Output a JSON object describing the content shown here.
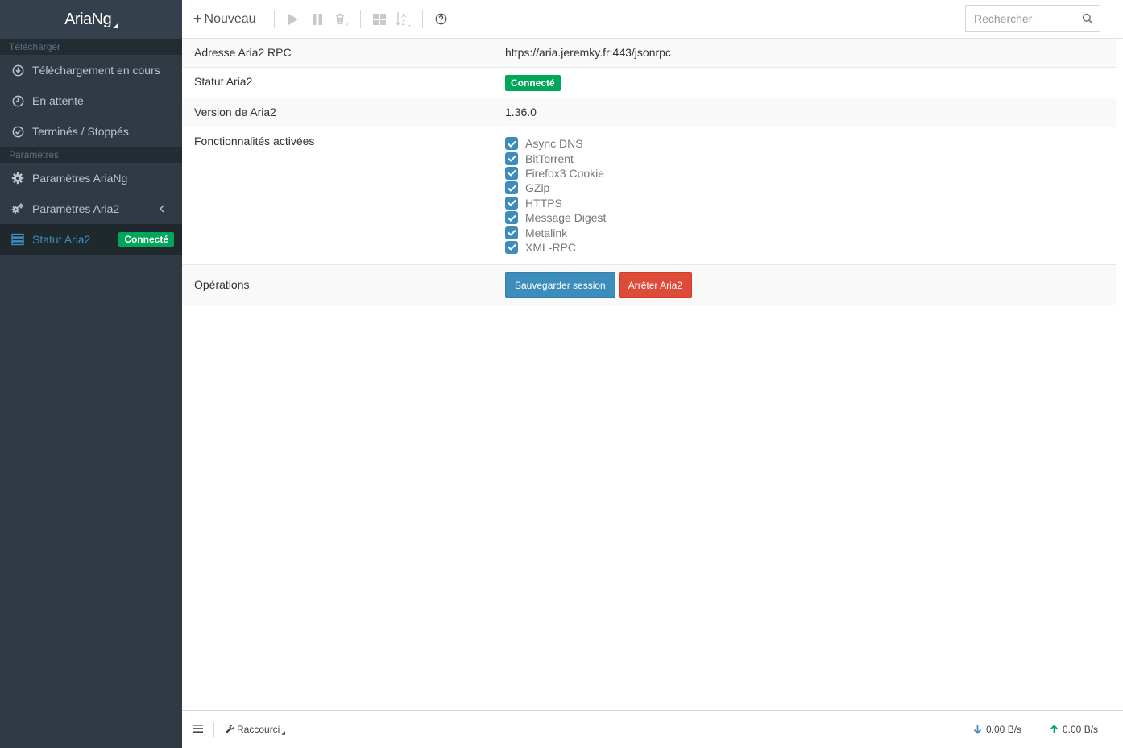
{
  "app": {
    "brand": "AriaNg"
  },
  "sidebar": {
    "section_download": "Télécharger",
    "section_settings": "Paramètres",
    "items": [
      {
        "label": "Téléchargement en cours",
        "icon": "arrow-circle-down-icon"
      },
      {
        "label": "En attente",
        "icon": "clock-icon"
      },
      {
        "label": "Terminés / Stoppés",
        "icon": "check-circle-icon"
      },
      {
        "label": "Paramètres AriaNg",
        "icon": "gear-icon"
      },
      {
        "label": "Paramètres Aria2",
        "icon": "gears-icon"
      },
      {
        "label": "Statut Aria2",
        "icon": "server-icon",
        "badge": "Connecté"
      }
    ]
  },
  "toolbar": {
    "new_label": "Nouveau",
    "search_placeholder": "Rechercher"
  },
  "status": {
    "rpc_label": "Adresse Aria2 RPC",
    "rpc_value": "https://aria.jeremky.fr:443/jsonrpc",
    "status_label": "Statut Aria2",
    "status_value": "Connecté",
    "version_label": "Version de Aria2",
    "version_value": "1.36.0",
    "features_label": "Fonctionnalités activées",
    "features": [
      "Async DNS",
      "BitTorrent",
      "Firefox3 Cookie",
      "GZip",
      "HTTPS",
      "Message Digest",
      "Metalink",
      "XML-RPC"
    ],
    "operations_label": "Opérations",
    "save_session": "Sauvegarder session",
    "stop_aria2": "Arrêter Aria2"
  },
  "footer": {
    "shortcut_label": "Raccourci",
    "download_speed": "0.00 B/s",
    "upload_speed": "0.00 B/s"
  },
  "colors": {
    "sidebar_bg": "#2f3a44",
    "accent": "#3c8dbc",
    "success": "#00a65a",
    "danger": "#dd4b39"
  }
}
